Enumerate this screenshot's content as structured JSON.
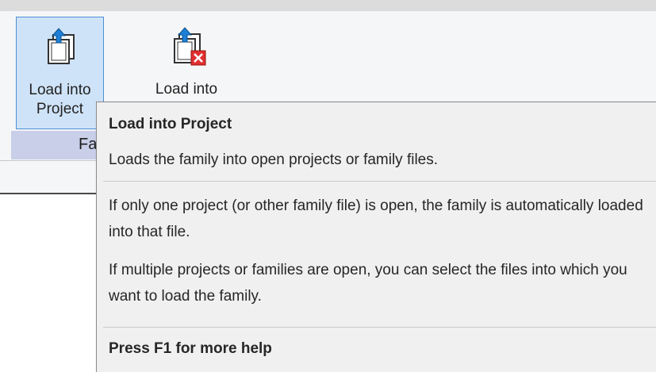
{
  "ribbon": {
    "panel_label": "Fa",
    "buttons": {
      "load_into_project": {
        "label": "Load into\nProject",
        "icon": "load-into-project-icon"
      },
      "load_into_family": {
        "label": "Load into",
        "icon": "load-into-project-and-close-icon"
      }
    }
  },
  "tooltip": {
    "title": "Load into Project",
    "description": "Loads the family into open projects or family files.",
    "paragraph_1": "If only one project (or other family file) is open, the family is automatically loaded into that file.",
    "paragraph_2": "If multiple projects or families are open, you can select the files into which you want to load the family.",
    "footer": "Press F1 for more help"
  },
  "colors": {
    "selected_button_bg": "#cfe3f8",
    "selected_button_border": "#4d8fd6",
    "panel_label_bar": "#c9cfe8",
    "tooltip_bg": "#f0f0f0"
  }
}
